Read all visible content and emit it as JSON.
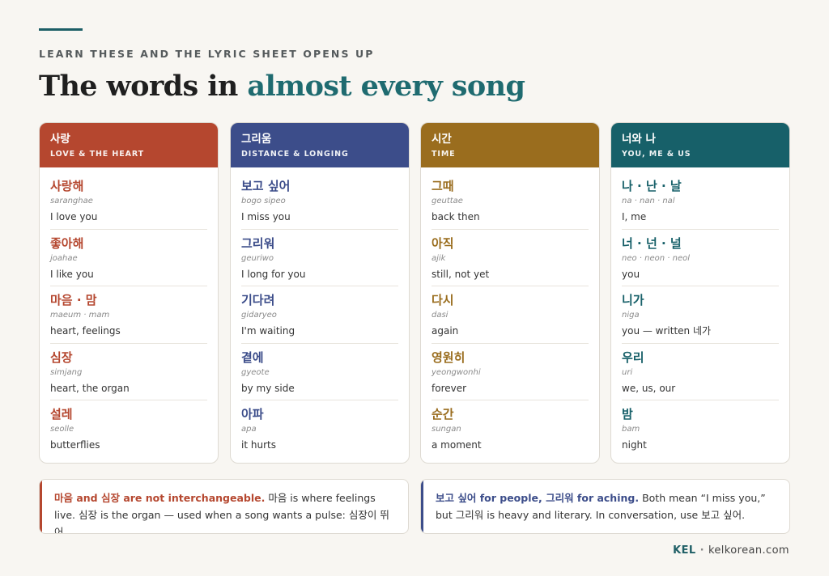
{
  "header": {
    "kicker": "LEARN THESE AND THE LYRIC SHEET OPENS UP",
    "title_plain": "The words in ",
    "title_accent": "almost every song"
  },
  "colors": {
    "love": "#b5472f",
    "longing": "#3c4d8a",
    "time": "#9a6d1e",
    "you_me": "#176069",
    "accent_teal": "#1f6b70"
  },
  "cards": [
    {
      "title": "사랑",
      "subtitle": "LOVE & THE HEART",
      "entries": [
        {
          "ko": "사랑해",
          "rom": "saranghae",
          "en": "I love you"
        },
        {
          "ko": "좋아해",
          "rom": "joahae",
          "en": "I like you"
        },
        {
          "ko": "마음 · 맘",
          "rom": "maeum · mam",
          "en": "heart, feelings"
        },
        {
          "ko": "심장",
          "rom": "simjang",
          "en": "heart, the organ"
        },
        {
          "ko": "설레",
          "rom": "seolle",
          "en": "butterflies"
        }
      ]
    },
    {
      "title": "그리움",
      "subtitle": "DISTANCE & LONGING",
      "entries": [
        {
          "ko": "보고 싶어",
          "rom": "bogo sipeo",
          "en": "I miss you"
        },
        {
          "ko": "그리워",
          "rom": "geuriwo",
          "en": "I long for you"
        },
        {
          "ko": "기다려",
          "rom": "gidaryeo",
          "en": "I'm waiting"
        },
        {
          "ko": "곁에",
          "rom": "gyeote",
          "en": "by my side"
        },
        {
          "ko": "아파",
          "rom": "apa",
          "en": "it hurts"
        }
      ]
    },
    {
      "title": "시간",
      "subtitle": "TIME",
      "entries": [
        {
          "ko": "그때",
          "rom": "geuttae",
          "en": "back then"
        },
        {
          "ko": "아직",
          "rom": "ajik",
          "en": "still, not yet"
        },
        {
          "ko": "다시",
          "rom": "dasi",
          "en": "again"
        },
        {
          "ko": "영원히",
          "rom": "yeongwonhi",
          "en": "forever"
        },
        {
          "ko": "순간",
          "rom": "sungan",
          "en": "a moment"
        }
      ]
    },
    {
      "title": "너와 나",
      "subtitle": "YOU, ME & US",
      "entries": [
        {
          "ko": "나 · 난 · 날",
          "rom": "na · nan · nal",
          "en": "I, me"
        },
        {
          "ko": "너 · 넌 · 널",
          "rom": "neo · neon · neol",
          "en": "you"
        },
        {
          "ko": "니가",
          "rom": "niga",
          "en": "you — written 네가"
        },
        {
          "ko": "우리",
          "rom": "uri",
          "en": "we, us, our"
        },
        {
          "ko": "밤",
          "rom": "bam",
          "en": "night"
        }
      ]
    }
  ],
  "notes": [
    {
      "lead": "마음 and 심장 are not interchangeable.",
      "body": " 마음 is where feelings live. 심장 is the organ — used when a song wants a pulse: 심장이 뛰어."
    },
    {
      "lead": "보고 싶어 for people, 그리워 for aching.",
      "body": " Both mean “I miss you,” but 그리워 is heavy and literary. In conversation, use 보고 싶어."
    }
  ],
  "footer": {
    "brand": "KEL",
    "separator": "·",
    "site": "kelkorean.com"
  }
}
